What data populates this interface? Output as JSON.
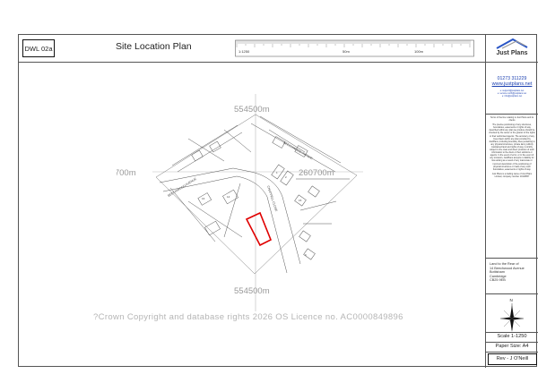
{
  "header": {
    "drawing_number": "DWL 02a",
    "title": "Site Location Plan",
    "scalebar_labels": [
      "1:1250",
      "50m",
      "100m"
    ]
  },
  "side_panel": {
    "logo_text": "Just Plans",
    "phone": "01273 311229",
    "website": "www.justplans.net",
    "tiny_lines": [
      "e: support@justplans.net",
      "e: service.north@justplans.net",
      "e: info@justplans.net"
    ],
    "terms": [
      "Terms of Service relating to Just Plans and its clients",
      "The precise positioning of any structures, boundaries, easements or rights of way described within any plan we produce should be checked by the owner or the grantor of the rights or their authorised agents. The accuracy of any lines drawn within any plan provided by JustPlans, including boundary lines pertaining to any physical structures, private land, publicly maintained land and rights of way, is strictly subject to the clear and direct provision of such information to the client or their solicitors or agents. In the event of error, or in the event of any omission, JustPlans accepts no liability for loss arising as a result of any inaccurate or incorrect description of the positioning of physical structures or rivals of any such boundaries, easements or rights of way.",
      "Just Plans is a trading name of Just Plans Limited, company number 10119657"
    ],
    "address_lines": [
      "Land to the Rear of",
      "14 Beechwood Avenue",
      "Bottisham",
      "Cambridge",
      "CB25 9EB"
    ],
    "north_label": "N",
    "scale": "Scale 1-1250",
    "paper_size": "Paper Size: A4",
    "revision": "Rev - J O'Neill"
  },
  "map": {
    "northing_label": "554500m",
    "easting_label": "260700m",
    "road_labels": [
      "BEECHWOOD AVENUE",
      "BEECHWOOD AVENUE",
      "CHAPPELL CLOSE"
    ],
    "house_numbers": [
      "1",
      "2",
      "14",
      "16",
      "15",
      "9"
    ],
    "site_outline_color": "#e00000"
  },
  "copyright": "?Crown Copyright and database rights 2026 OS Licence no. AC0000849896"
}
